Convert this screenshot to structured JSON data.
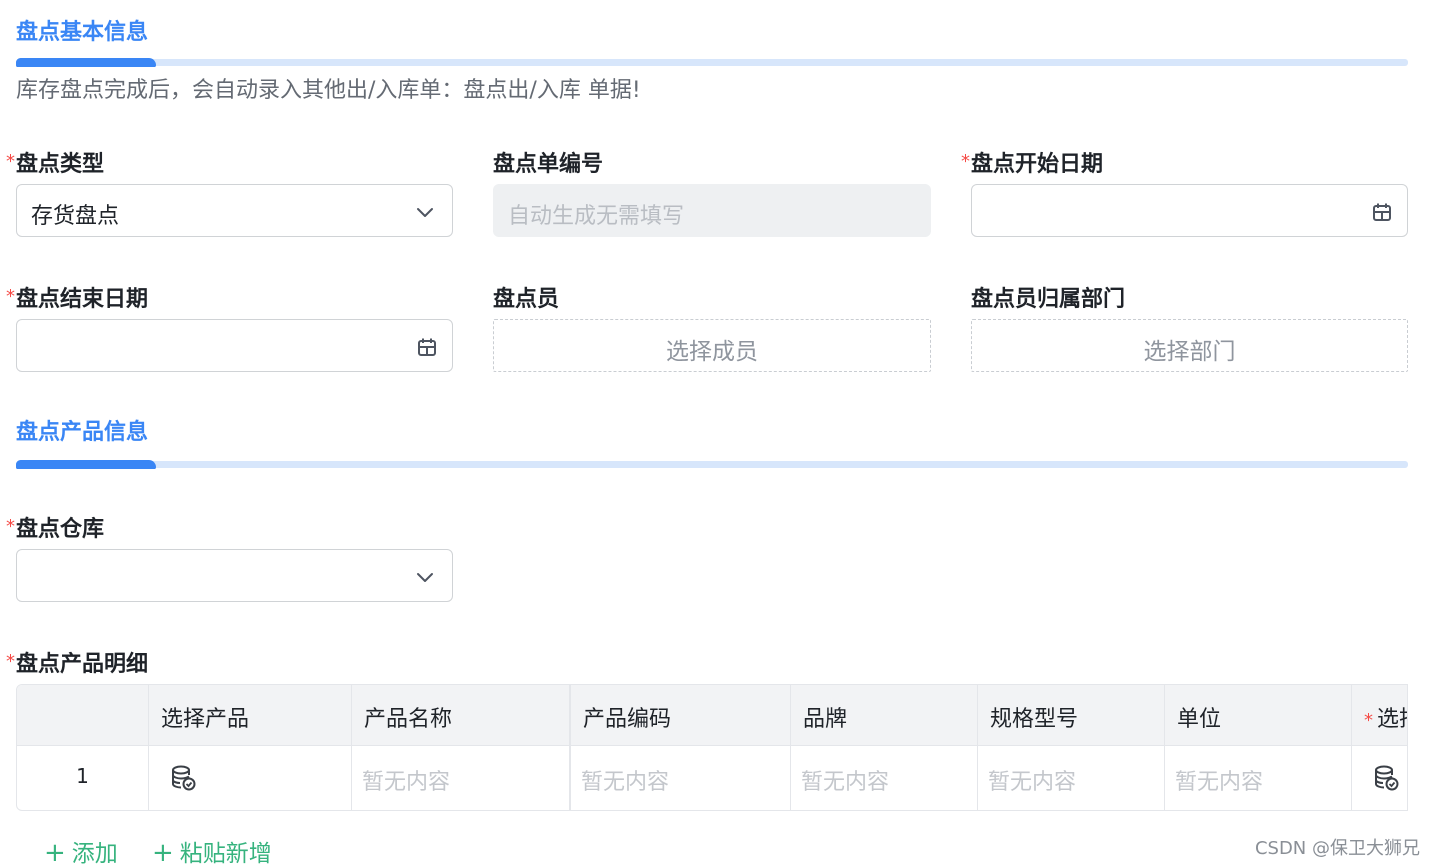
{
  "section_basic": {
    "title": "盘点基本信息",
    "hint": "库存盘点完成后，会自动录入其他出/入库单：盘点出/入库 单据!"
  },
  "fields": {
    "inventory_type": {
      "label": "盘点类型",
      "required": true,
      "value": "存货盘点",
      "icon": "chevron-down-icon"
    },
    "doc_number": {
      "label": "盘点单编号",
      "required": false,
      "placeholder": "自动生成无需填写"
    },
    "start_date": {
      "label": "盘点开始日期",
      "required": true,
      "value": "",
      "icon": "calendar-icon"
    },
    "end_date": {
      "label": "盘点结束日期",
      "required": true,
      "value": "",
      "icon": "calendar-icon"
    },
    "counter": {
      "label": "盘点员",
      "required": false,
      "button": "选择成员"
    },
    "department": {
      "label": "盘点员归属部门",
      "required": false,
      "button": "选择部门"
    }
  },
  "section_product": {
    "title": "盘点产品信息"
  },
  "warehouse": {
    "label": "盘点仓库",
    "required": true,
    "value": "",
    "icon": "chevron-down-icon"
  },
  "detail": {
    "label": "盘点产品明细",
    "required": true,
    "columns": [
      "",
      "选择产品",
      "产品名称",
      "产品编码",
      "品牌",
      "规格型号",
      "单位",
      "选择"
    ],
    "last_column_required": true,
    "rows": [
      {
        "index": "1",
        "product_icon": "database-check-icon",
        "name": "暂无内容",
        "code": "暂无内容",
        "brand": "暂无内容",
        "spec": "暂无内容",
        "unit": "暂无内容",
        "select_icon": "database-check-icon"
      }
    ],
    "add_label": "添加",
    "paste_label": "粘贴新增"
  },
  "watermark": "CSDN @保卫大狮兄",
  "colors": {
    "accent": "#3a86f5",
    "required": "#f54a45",
    "add": "#36b37e"
  }
}
